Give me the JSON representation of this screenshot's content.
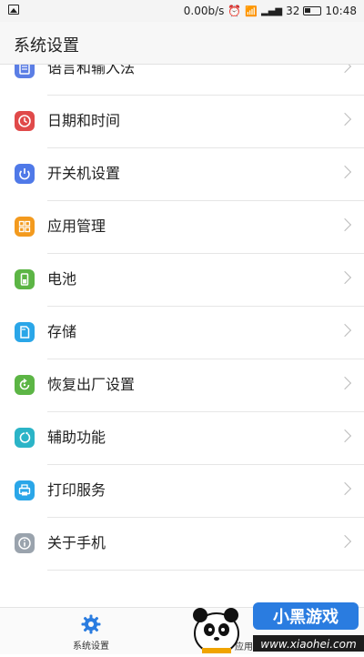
{
  "status_bar": {
    "speed": "0.00b/s",
    "signal": "32",
    "time": "10:48"
  },
  "header": {
    "title": "系统设置"
  },
  "items": [
    {
      "label": "语言和输入法",
      "icon": "keyboard-icon",
      "color": "#5b7ee5"
    },
    {
      "label": "日期和时间",
      "icon": "clock-icon",
      "color": "#e04a4a"
    },
    {
      "label": "开关机设置",
      "icon": "power-icon",
      "color": "#4f79e8"
    },
    {
      "label": "应用管理",
      "icon": "grid-icon",
      "color": "#f39a1e"
    },
    {
      "label": "电池",
      "icon": "battery-icon",
      "color": "#5cb545"
    },
    {
      "label": "存储",
      "icon": "storage-icon",
      "color": "#2aa6e8"
    },
    {
      "label": "恢复出厂设置",
      "icon": "restore-icon",
      "color": "#5cb545"
    },
    {
      "label": "辅助功能",
      "icon": "accessibility-icon",
      "color": "#2bb4c7"
    },
    {
      "label": "打印服务",
      "icon": "printer-icon",
      "color": "#2aa6e8"
    },
    {
      "label": "关于手机",
      "icon": "info-icon",
      "color": "#9aa3ad"
    }
  ],
  "bottom_nav": {
    "tabs": [
      {
        "label": "系统设置",
        "icon": "gear-icon",
        "color": "#2a7ce0"
      },
      {
        "label": "应用设"
      }
    ]
  },
  "watermark": {
    "text": "www.xiaohei.com",
    "brand": "小黑游戏"
  }
}
